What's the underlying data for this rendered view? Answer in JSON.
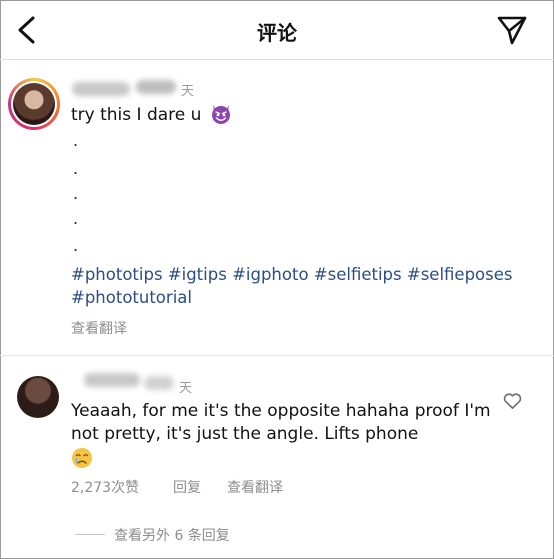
{
  "header": {
    "title": "评论",
    "back_icon": "chevron-left-icon",
    "send_icon": "paper-plane-icon"
  },
  "post": {
    "time_suffix": "天",
    "caption": "try this I dare u",
    "caption_emoji": "smiling-devil-emoji",
    "dots": [
      ".",
      ".",
      ".",
      ".",
      "."
    ],
    "hashtags": [
      "#phototips",
      "#igtips",
      "#igphoto",
      "#selfietips",
      "#selfieposes",
      "#phototutorial"
    ],
    "translate": "查看翻译"
  },
  "comment": {
    "time_suffix": "天",
    "text": "Yeaaah, for me it's the opposite hahaha proof I'm not pretty, it's just the angle. Lifts phone",
    "emoji": "crying-face-emoji",
    "likes": "2,273次赞",
    "reply": "回复",
    "translate": "查看翻译",
    "view_replies": "查看另外 6 条回复",
    "like_icon": "heart-outline-icon"
  },
  "colors": {
    "hashtag": "#2c4d86",
    "muted": "#8e8e8e",
    "story_ring": [
      "#f9c440",
      "#e1306c",
      "#c13584"
    ]
  }
}
